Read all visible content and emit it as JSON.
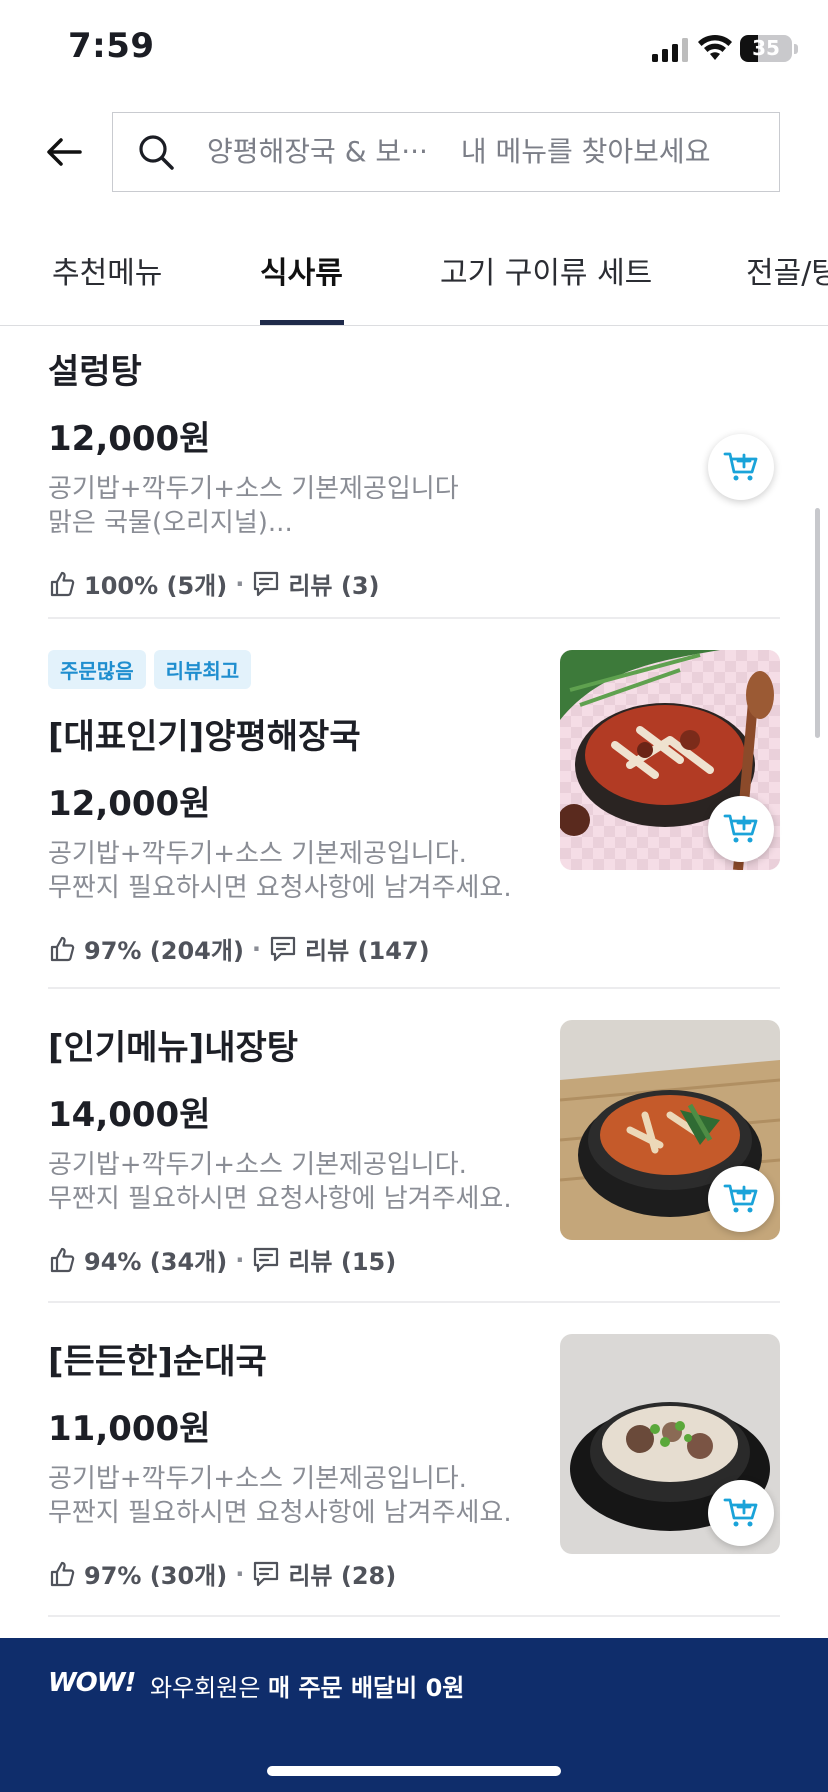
{
  "status_bar": {
    "time": "7:59",
    "battery": "35",
    "battery_level": 0.35
  },
  "search": {
    "store_name": "양평해장국 & 보···",
    "placeholder": "내 메뉴를 찾아보세요"
  },
  "tabs": [
    {
      "label": "추천메뉴",
      "active": false
    },
    {
      "label": "식사류",
      "active": true
    },
    {
      "label": "고기 구이류 세트",
      "active": false
    },
    {
      "label": "전골/탕",
      "active": false
    }
  ],
  "menu_items": [
    {
      "name": "설렁탕",
      "price": "12,000원",
      "desc1": "공기밥+깍두기+소스 기본제공입니다",
      "desc2": "맑은 국물(오리지널)...",
      "rating": "100% (5개)",
      "review": "리뷰 (3)",
      "has_image": false
    },
    {
      "badges": [
        "주문많음",
        "리뷰최고"
      ],
      "name": "[대표인기]양평해장국",
      "price": "12,000원",
      "desc1": "공기밥+깍두기+소스  기본제공입니다.",
      "desc2": "무짠지 필요하시면 요청사항에 남겨주세요.",
      "rating": "97% (204개)",
      "review": "리뷰 (147)",
      "has_image": true
    },
    {
      "name": "[인기메뉴]내장탕",
      "price": "14,000원",
      "desc1": "공기밥+깍두기+소스 기본제공입니다.",
      "desc2": "무짠지 필요하시면 요청사항에 남겨주세요.",
      "rating": "94% (34개)",
      "review": "리뷰 (15)",
      "has_image": true
    },
    {
      "name": "[든든한]순대국",
      "price": "11,000원",
      "desc1": "공기밥+깍두기+소스 기본제공입니다.",
      "desc2": "무짠지 필요하시면 요청사항에 남겨주세요.",
      "rating": "97% (30개)",
      "review": "리뷰 (28)",
      "has_image": true
    }
  ],
  "banner": {
    "logo": "WOW!",
    "text_prefix": "와우회원은 ",
    "text_bold": "매 주문 배달비 0원"
  },
  "colors": {
    "banner_bg": "#0f2d6b",
    "badge_text": "#1f8ecf",
    "badge_bg": "#e3f2fb",
    "cart_icon": "#1aa3d9",
    "tab_underline": "#1f2a4a"
  }
}
